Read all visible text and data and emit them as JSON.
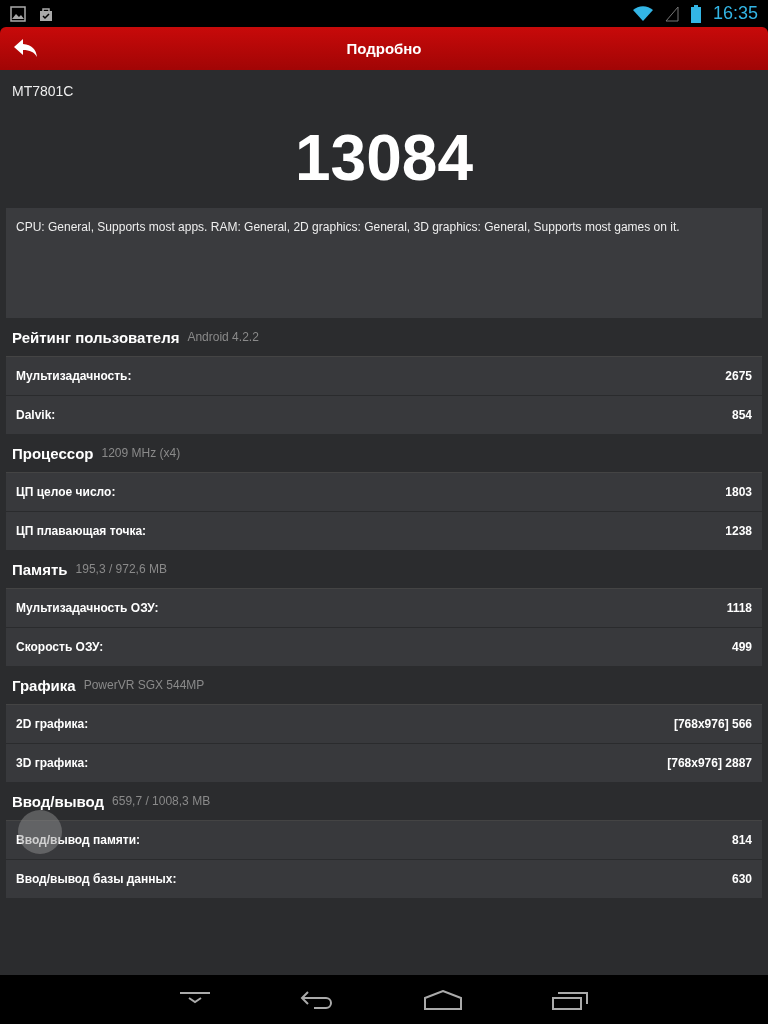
{
  "status_bar": {
    "time": "16:35"
  },
  "header": {
    "title": "Подробно"
  },
  "device": "MT7801C",
  "score": "13084",
  "description": "CPU: General, Supports most apps. RAM: General, 2D graphics: General, 3D graphics: General, Supports most games on it.",
  "sections": [
    {
      "title": "Рейтинг пользователя",
      "subtitle": "Android 4.2.2",
      "rows": [
        {
          "label": "Мультизадачность:",
          "value": "2675"
        },
        {
          "label": "Dalvik:",
          "value": "854"
        }
      ]
    },
    {
      "title": "Процессор",
      "subtitle": "1209 MHz (x4)",
      "rows": [
        {
          "label": "ЦП целое число:",
          "value": "1803"
        },
        {
          "label": "ЦП плавающая точка:",
          "value": "1238"
        }
      ]
    },
    {
      "title": "Память",
      "subtitle": "195,3 / 972,6 MB",
      "rows": [
        {
          "label": "Мультизадачность ОЗУ:",
          "value": "1118"
        },
        {
          "label": "Скорость ОЗУ:",
          "value": "499"
        }
      ]
    },
    {
      "title": "Графика",
      "subtitle": "PowerVR SGX 544MP",
      "rows": [
        {
          "label": "2D графика:",
          "value": "[768x976] 566"
        },
        {
          "label": "3D графика:",
          "value": "[768x976] 2887"
        }
      ]
    },
    {
      "title": "Ввод/вывод",
      "subtitle": "659,7 / 1008,3 MB",
      "rows": [
        {
          "label": "Ввод/вывод памяти:",
          "value": "814"
        },
        {
          "label": "Ввод/вывод базы данных:",
          "value": "630"
        }
      ]
    }
  ]
}
